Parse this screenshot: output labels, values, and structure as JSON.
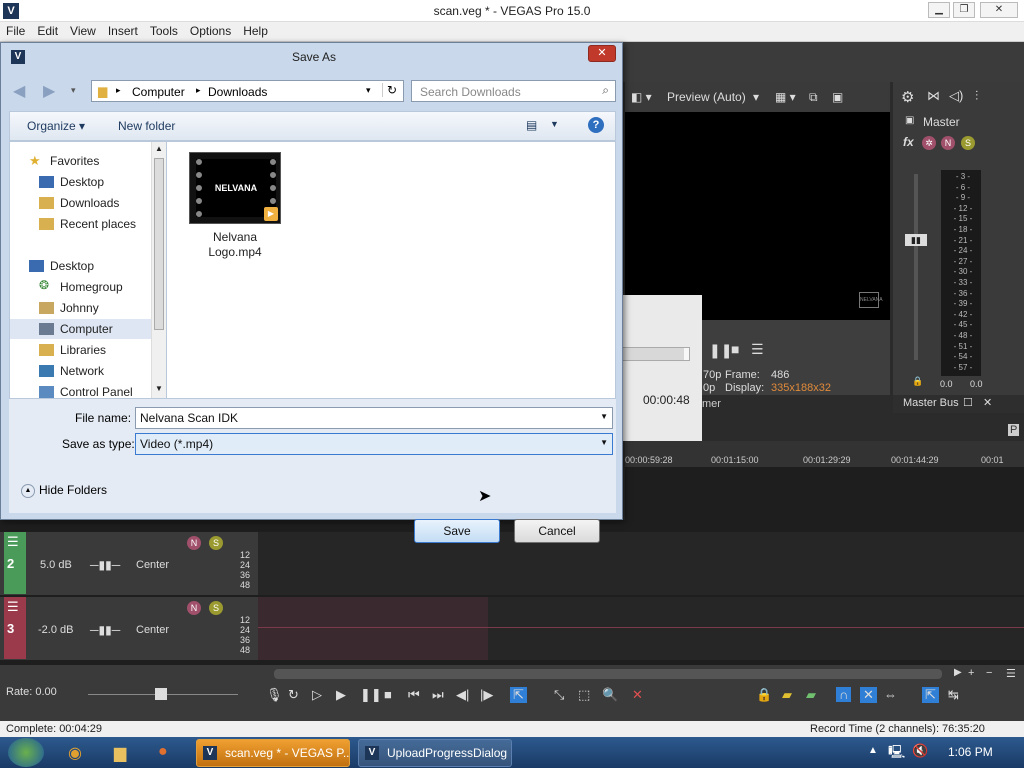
{
  "app": {
    "title": "scan.veg * - VEGAS Pro 15.0",
    "logo_letter": "V"
  },
  "menu": [
    "File",
    "Edit",
    "View",
    "Insert",
    "Tools",
    "Options",
    "Help"
  ],
  "preview": {
    "mode": "Preview (Auto)",
    "watermark": "NELVANA",
    "frame_label": "Frame:",
    "frame_value": "486",
    "display_label": "Display:",
    "display_value": "335x188x32",
    "partial1": "70p",
    "partial2": "0p",
    "partial3": "mer"
  },
  "mixer": {
    "master_label": "Master",
    "bus_label": "Master Bus",
    "fx_label": "fx",
    "db_scale": [
      "3",
      "6",
      "9",
      "12",
      "15",
      "18",
      "21",
      "24",
      "27",
      "30",
      "33",
      "36",
      "39",
      "42",
      "45",
      "48",
      "51",
      "54",
      "57"
    ],
    "left_val": "0.0",
    "right_val": "0.0"
  },
  "upload": {
    "time": "00:00:48",
    "progress": 0.93
  },
  "timeline": {
    "ticks": [
      "00:00:59:28",
      "00:01:15:00",
      "00:01:29:29",
      "00:01:44:29",
      "00:01"
    ]
  },
  "tracks": [
    {
      "num": "2",
      "vol": "5.0 dB",
      "pan": "Center",
      "scale": [
        "12",
        "24",
        "36",
        "48"
      ],
      "color": "#4a9a5a"
    },
    {
      "num": "3",
      "vol": "-2.0 dB",
      "pan": "Center",
      "scale": [
        "12",
        "24",
        "36",
        "48"
      ],
      "color": "#9a3a4a"
    }
  ],
  "rate": {
    "label": "Rate: 0.00"
  },
  "status": {
    "complete": "Complete: 00:04:29",
    "record": "Record Time (2 channels): 76:35:20"
  },
  "taskbar": {
    "items": [
      "scan.veg * - VEGAS P...",
      "UploadProgressDialog"
    ],
    "time": "1:06 PM"
  },
  "dialog": {
    "title": "Save As",
    "close": "✕",
    "breadcrumb": [
      "Computer",
      "Downloads"
    ],
    "search_placeholder": "Search Downloads",
    "organize": "Organize",
    "new_folder": "New folder",
    "nav": [
      {
        "label": "Favorites",
        "icon": "star"
      },
      {
        "label": "Desktop",
        "icon": "desktop"
      },
      {
        "label": "Downloads",
        "icon": "folder"
      },
      {
        "label": "Recent places",
        "icon": "folder"
      },
      {
        "label": "Desktop",
        "icon": "desktop"
      },
      {
        "label": "Homegroup",
        "icon": "homegroup"
      },
      {
        "label": "Johnny",
        "icon": "user"
      },
      {
        "label": "Computer",
        "icon": "computer"
      },
      {
        "label": "Libraries",
        "icon": "folder"
      },
      {
        "label": "Network",
        "icon": "network"
      },
      {
        "label": "Control Panel",
        "icon": "control"
      }
    ],
    "file": {
      "name_line1": "Nelvana",
      "name_line2": "Logo.mp4",
      "thumb_text": "NELVANA"
    },
    "filename_label": "File name:",
    "filename_value": "Nelvana Scan IDK",
    "type_label": "Save as type:",
    "type_value": "Video (*.mp4)",
    "hide_folders": "Hide Folders",
    "save": "Save",
    "cancel": "Cancel"
  }
}
